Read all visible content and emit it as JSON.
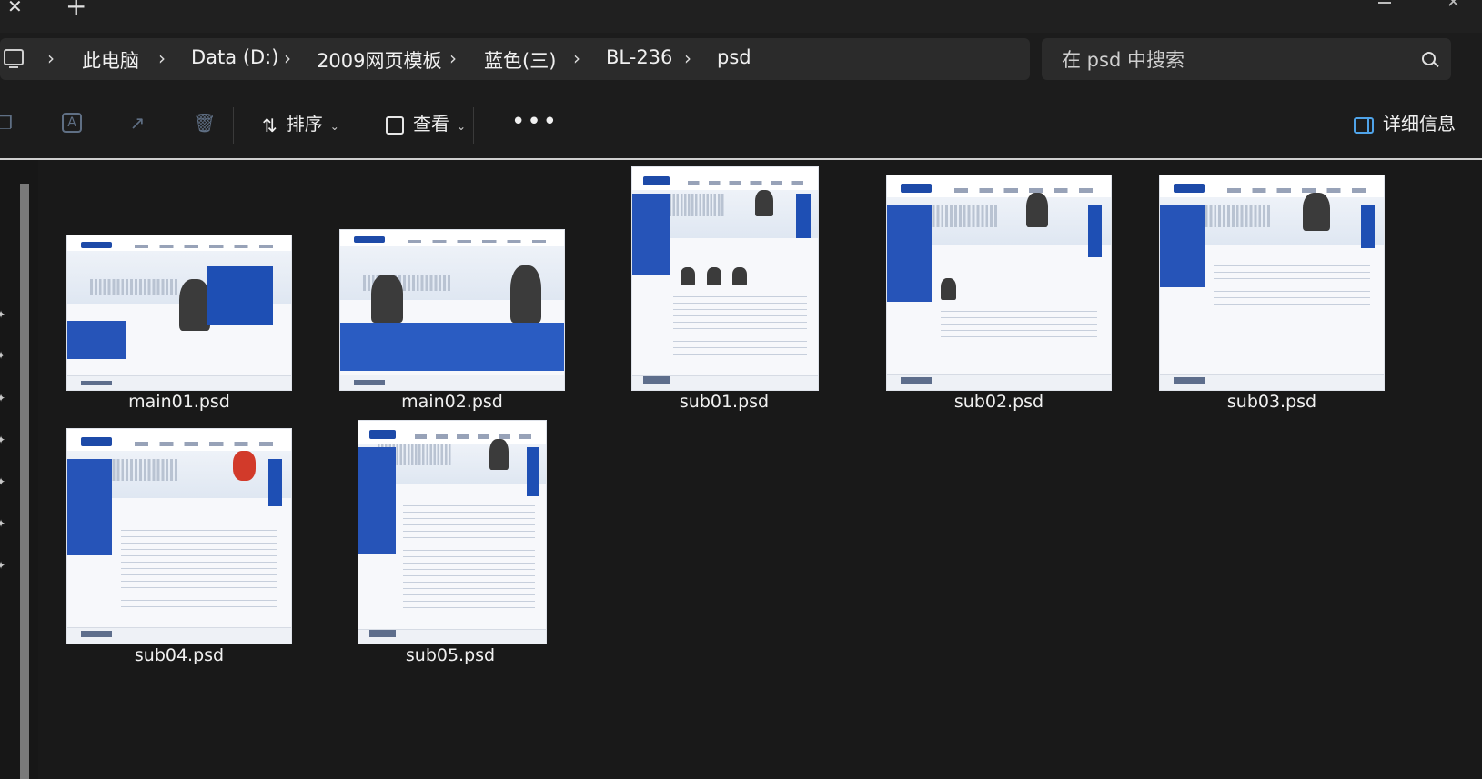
{
  "window": {
    "tab_close_glyph": "✕",
    "tab_new_glyph": "+"
  },
  "breadcrumb": [
    "此电脑",
    "Data (D:)",
    "2009网页模板",
    "蓝色(三)",
    "BL-236",
    "psd"
  ],
  "search": {
    "placeholder": "在 psd 中搜索"
  },
  "toolbar": {
    "sort_label": "排序",
    "view_label": "查看",
    "more_label": "•••",
    "details_label": "详细信息",
    "icons": [
      "copy-icon",
      "rename-icon",
      "share-icon",
      "delete-icon"
    ]
  },
  "files": [
    {
      "name": "main01.psd"
    },
    {
      "name": "main02.psd"
    },
    {
      "name": "sub01.psd"
    },
    {
      "name": "sub02.psd"
    },
    {
      "name": "sub03.psd"
    },
    {
      "name": "sub04.psd"
    },
    {
      "name": "sub05.psd"
    }
  ],
  "colors": {
    "accent": "#4fa3e8",
    "background": "#1c1c1c",
    "thumb_blue": "#2654b8"
  }
}
